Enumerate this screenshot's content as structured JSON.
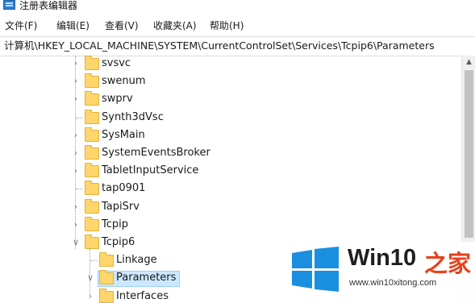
{
  "window": {
    "title": "注册表编辑器"
  },
  "menu": [
    {
      "label": "文件(F)"
    },
    {
      "label": "编辑(E)"
    },
    {
      "label": "查看(V)"
    },
    {
      "label": "收藏夹(A)"
    },
    {
      "label": "帮助(H)"
    }
  ],
  "address": {
    "path": "计算机\\HKEY_LOCAL_MACHINE\\SYSTEM\\CurrentControlSet\\Services\\Tcpip6\\Parameters"
  },
  "tree": {
    "items": [
      {
        "label": "svsvc",
        "expander": "collapsed"
      },
      {
        "label": "swenum",
        "expander": "collapsed"
      },
      {
        "label": "swprv",
        "expander": "collapsed"
      },
      {
        "label": "Synth3dVsc",
        "expander": "none"
      },
      {
        "label": "SysMain",
        "expander": "collapsed"
      },
      {
        "label": "SystemEventsBroker",
        "expander": "collapsed"
      },
      {
        "label": "TabletInputService",
        "expander": "collapsed"
      },
      {
        "label": "tap0901",
        "expander": "none"
      },
      {
        "label": "TapiSrv",
        "expander": "collapsed"
      },
      {
        "label": "Tcpip",
        "expander": "collapsed"
      },
      {
        "label": "Tcpip6",
        "expander": "expanded"
      },
      {
        "label": "Linkage",
        "expander": "none"
      },
      {
        "label": "Parameters",
        "expander": "expanded",
        "selected": true
      },
      {
        "label": "Interfaces",
        "expander": "collapsed"
      }
    ]
  },
  "watermark": {
    "brand": "Win10",
    "brand_suffix": "之家",
    "url": "www.win10xitong.com",
    "logo_color": "#1a8fe0",
    "suffix_color": "#e8401a"
  },
  "colors": {
    "selection": "#cce8ff",
    "folder": "#ffd66b"
  }
}
